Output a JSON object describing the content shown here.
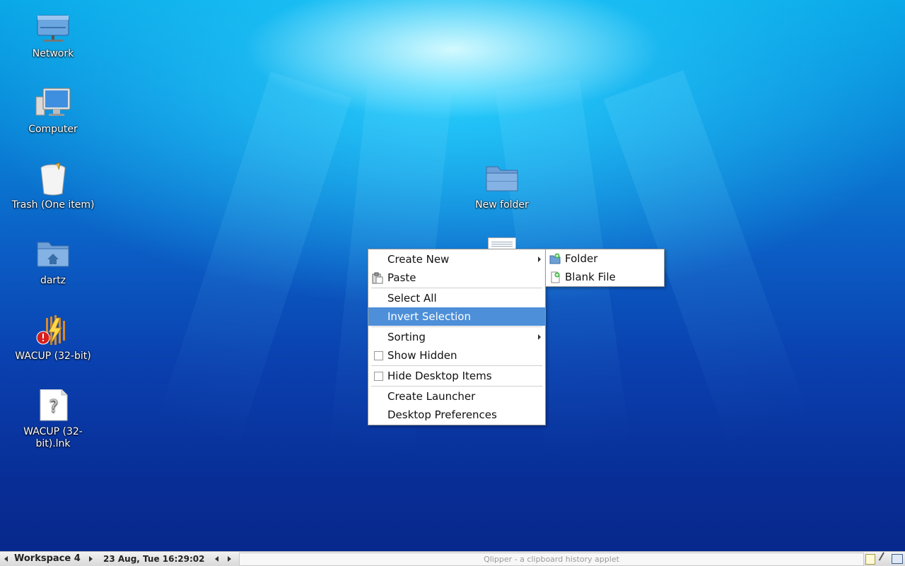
{
  "desktop": {
    "icons": [
      {
        "label": "Network",
        "icon": "network-icon"
      },
      {
        "label": "Computer",
        "icon": "computer-icon"
      },
      {
        "label": "Trash (One item)",
        "icon": "trash-icon"
      },
      {
        "label": "dartz",
        "icon": "home-folder-icon"
      },
      {
        "label": "WACUP (32-bit)",
        "icon": "wacup-icon"
      },
      {
        "label": "WACUP (32-\nbit).lnk",
        "icon": "unknown-file-icon"
      },
      {
        "label": "New folder",
        "icon": "folder-icon"
      }
    ]
  },
  "context_menu": {
    "items": [
      {
        "label": "Create New",
        "submenu": true
      },
      {
        "label": "Paste",
        "icon": "paste-icon"
      },
      {
        "label": "Select All"
      },
      {
        "label": "Invert Selection",
        "highlighted": true
      },
      {
        "label": "Sorting",
        "submenu": true
      },
      {
        "label": "Show Hidden",
        "checkbox": true,
        "checked": false
      },
      {
        "label": "Hide Desktop Items",
        "checkbox": true,
        "checked": false
      },
      {
        "label": "Create Launcher"
      },
      {
        "label": "Desktop Preferences"
      }
    ],
    "highlight_color": "#4d8fd8"
  },
  "submenu": {
    "items": [
      {
        "label": "Folder",
        "icon": "new-folder-icon"
      },
      {
        "label": "Blank File",
        "icon": "new-file-icon"
      }
    ]
  },
  "taskbar": {
    "workspace": "Workspace 4",
    "clock": "23 Aug, Tue 16:29:02",
    "clipboard_applet": "Qlipper - a clipboard history applet"
  }
}
